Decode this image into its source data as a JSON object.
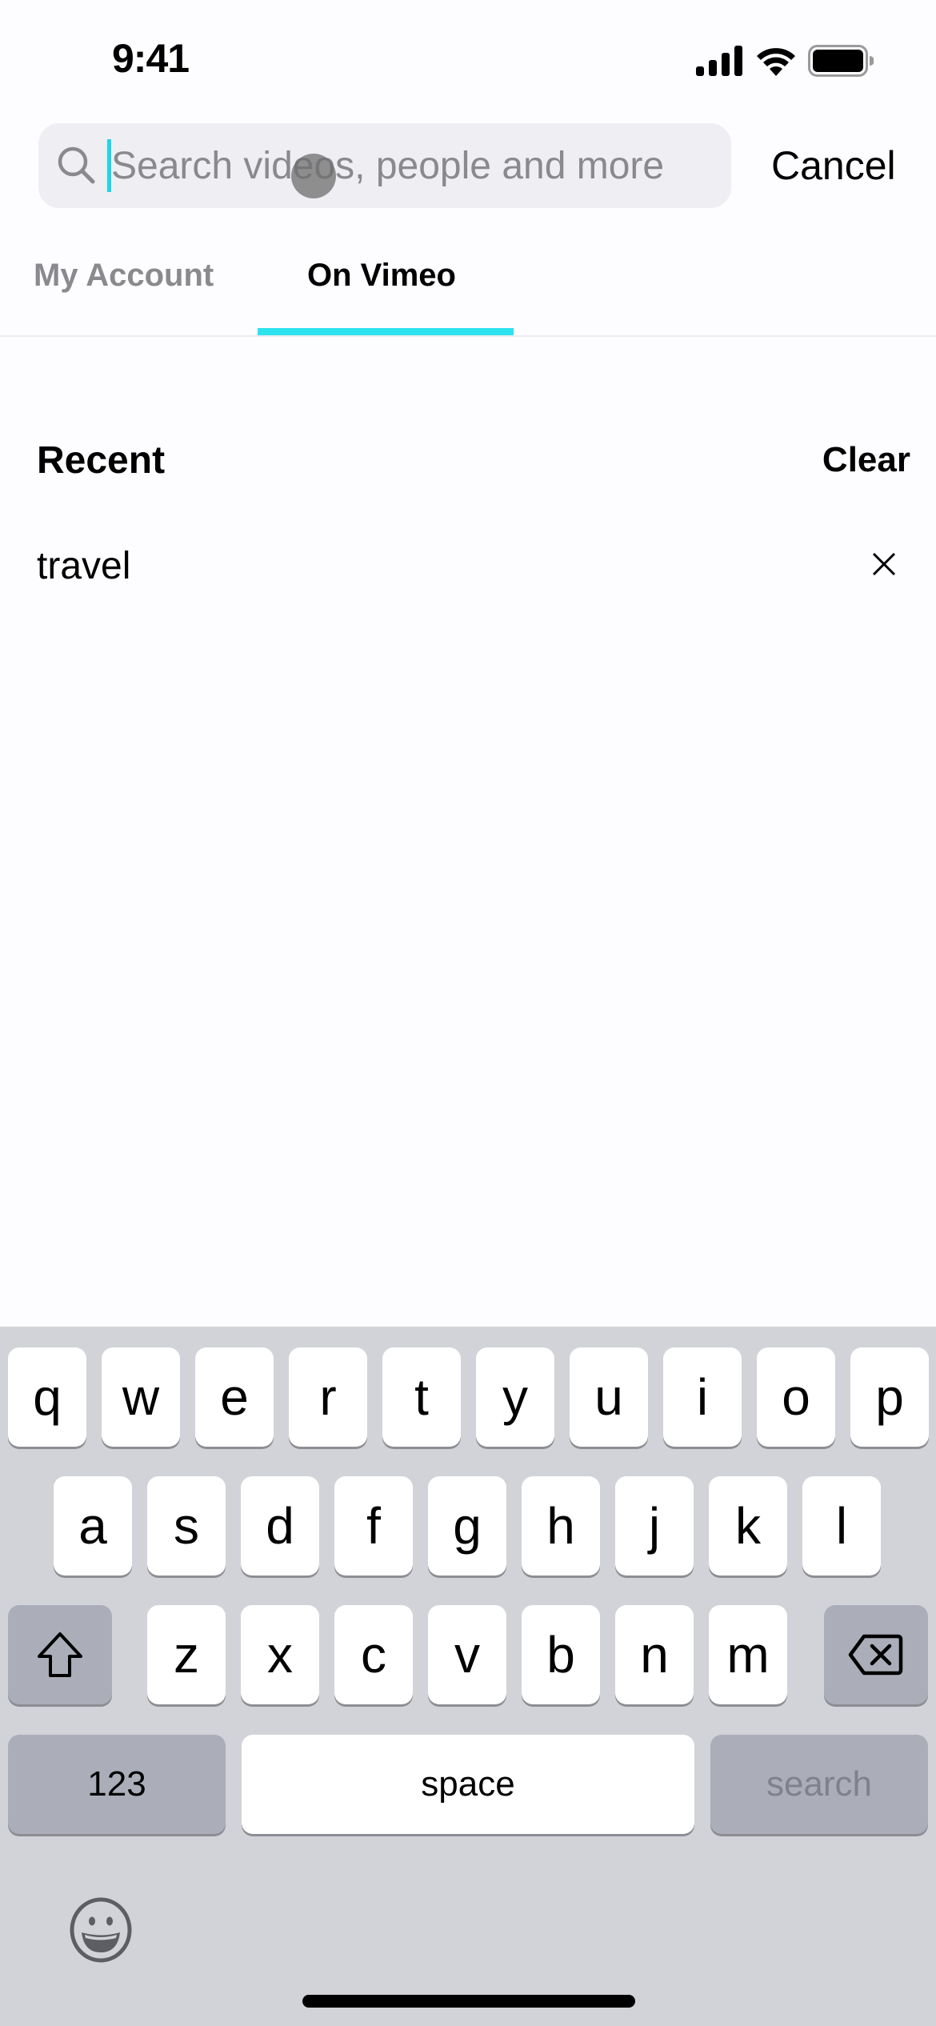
{
  "status_bar": {
    "time": "9:41",
    "icons": [
      "cellular-signal-icon",
      "wifi-icon",
      "battery-icon"
    ]
  },
  "search": {
    "placeholder": "Search videos, people and more",
    "value": "",
    "icon": "search-icon",
    "cancel_label": "Cancel",
    "cursor_color": "#1fd5ea"
  },
  "tabs": [
    {
      "label": "My Account",
      "selected": false
    },
    {
      "label": "On Vimeo",
      "selected": true
    }
  ],
  "tab_indicator_color": "#2ee2ee",
  "recent": {
    "title": "Recent",
    "clear_label": "Clear",
    "items": [
      {
        "text": "travel",
        "remove_icon": "close-icon"
      }
    ]
  },
  "keyboard": {
    "row1": [
      "q",
      "w",
      "e",
      "r",
      "t",
      "y",
      "u",
      "i",
      "o",
      "p"
    ],
    "row2": [
      "a",
      "s",
      "d",
      "f",
      "g",
      "h",
      "j",
      "k",
      "l"
    ],
    "row3": [
      "z",
      "x",
      "c",
      "v",
      "b",
      "n",
      "m"
    ],
    "shift_icon": "shift-icon",
    "delete_icon": "backspace-icon",
    "numbers_label": "123",
    "space_label": "space",
    "search_label": "search",
    "emoji_icon": "emoji-icon"
  }
}
